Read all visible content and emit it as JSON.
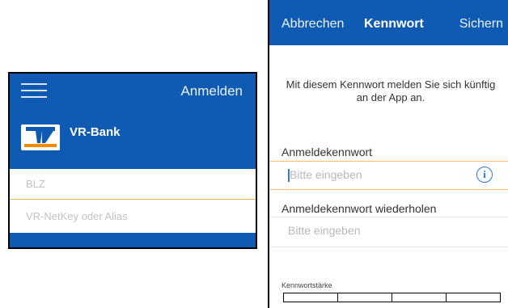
{
  "left": {
    "header_action": "Anmelden",
    "bank_name": "VR-Bank",
    "fields": {
      "blz_placeholder": "BLZ",
      "netkey_placeholder": "VR-NetKey oder Alias"
    },
    "colors": {
      "brand_blue": "#0f5ab3",
      "accent_orange": "#f28a00"
    },
    "icons": {
      "menu": "hamburger-icon",
      "logo": "vr-bank-logo"
    }
  },
  "right": {
    "header": {
      "cancel": "Abbrechen",
      "title": "Kennwort",
      "save": "Sichern"
    },
    "intro": "Mit diesem Kennwort melden Sie sich künftig an der App an.",
    "password": {
      "label": "Anmeldekennwort",
      "placeholder": "Bitte eingeben"
    },
    "password_repeat": {
      "label": "Anmeldekennwort wiederholen",
      "placeholder": "Bitte eingeben"
    },
    "strength": {
      "label": "Kennwortstärke",
      "segments": 4
    },
    "icons": {
      "info": "info-icon"
    },
    "info_glyph": "i"
  }
}
